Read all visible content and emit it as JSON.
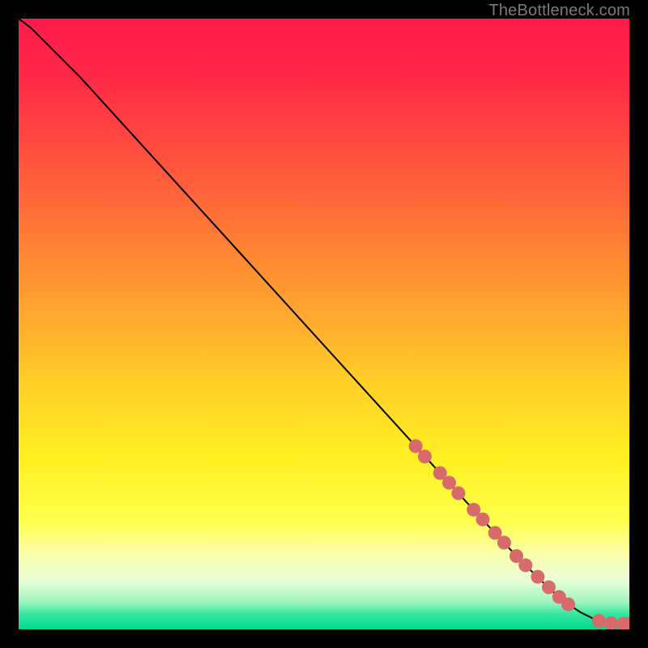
{
  "watermark": "TheBottleneck.com",
  "chart_data": {
    "type": "line",
    "title": "",
    "xlabel": "",
    "ylabel": "",
    "xlim": [
      0,
      100
    ],
    "ylim": [
      0,
      100
    ],
    "background_gradient": {
      "stops": [
        {
          "offset": 0.0,
          "color": "#ff1a4b"
        },
        {
          "offset": 0.1,
          "color": "#ff2a46"
        },
        {
          "offset": 0.22,
          "color": "#ff4e3e"
        },
        {
          "offset": 0.35,
          "color": "#ff7a36"
        },
        {
          "offset": 0.48,
          "color": "#ffa62f"
        },
        {
          "offset": 0.6,
          "color": "#ffd028"
        },
        {
          "offset": 0.72,
          "color": "#fff022"
        },
        {
          "offset": 0.82,
          "color": "#ffff4a"
        },
        {
          "offset": 0.88,
          "color": "#fbffb0"
        },
        {
          "offset": 0.92,
          "color": "#e9ffd8"
        },
        {
          "offset": 0.955,
          "color": "#9ff5c0"
        },
        {
          "offset": 0.975,
          "color": "#35e6a0"
        },
        {
          "offset": 1.0,
          "color": "#00d88c"
        }
      ]
    },
    "series": [
      {
        "name": "bottleneck-curve",
        "type": "line",
        "x": [
          0.0,
          2.0,
          4.0,
          6.5,
          10.0,
          20.0,
          30.0,
          40.0,
          50.0,
          60.0,
          65.0,
          70.0,
          75.0,
          80.0,
          85.0,
          88.0,
          90.0,
          92.0,
          94.0,
          96.0,
          98.0,
          100.0
        ],
        "y": [
          100.0,
          98.5,
          96.5,
          94.0,
          90.5,
          79.5,
          68.5,
          57.5,
          46.5,
          35.5,
          30.0,
          24.5,
          19.0,
          13.6,
          8.5,
          5.7,
          4.1,
          2.8,
          1.8,
          1.1,
          0.9,
          0.9
        ]
      },
      {
        "name": "highlight-dots",
        "type": "scatter",
        "color": "#d76a6a",
        "x": [
          65.0,
          66.5,
          69.0,
          70.5,
          72.0,
          74.5,
          76.0,
          78.0,
          79.5,
          81.5,
          83.0,
          85.0,
          86.8,
          88.5,
          90.0,
          95.0,
          97.0,
          99.0,
          100.0
        ],
        "y": [
          30.0,
          28.3,
          25.6,
          24.0,
          22.3,
          19.6,
          18.0,
          15.8,
          14.2,
          12.0,
          10.5,
          8.6,
          6.9,
          5.3,
          4.1,
          1.4,
          1.0,
          0.9,
          0.9
        ]
      }
    ]
  }
}
